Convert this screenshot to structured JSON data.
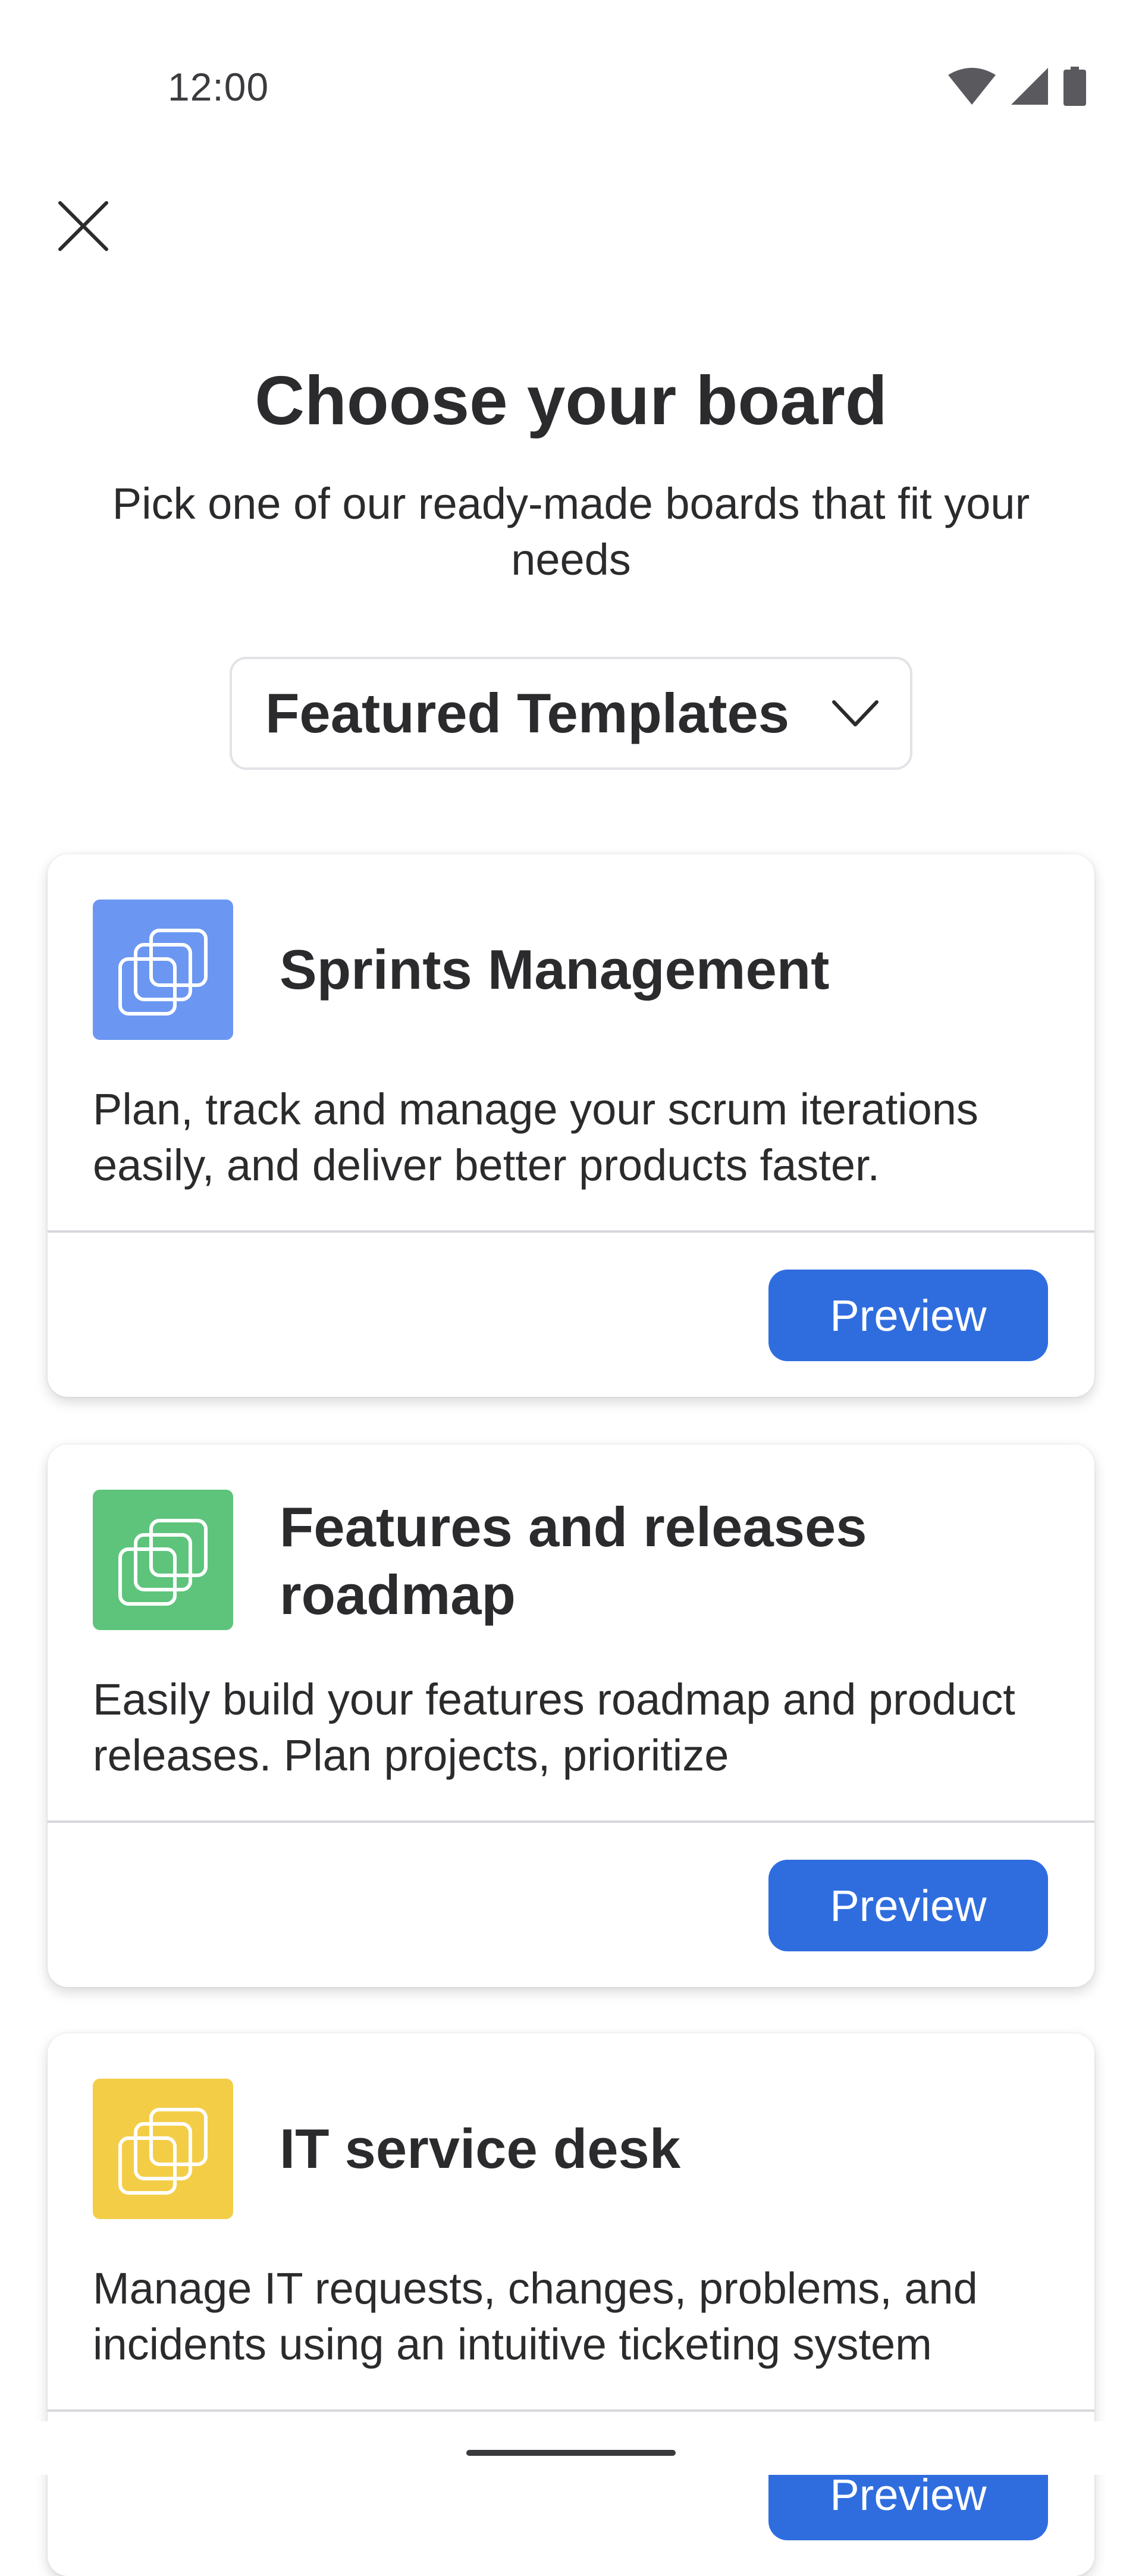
{
  "status_bar": {
    "time": "12:00",
    "icons": [
      "wifi-icon",
      "cellular-signal-icon",
      "battery-icon"
    ]
  },
  "header": {
    "close_icon": "close-icon",
    "title": "Choose your board",
    "subtitle": "Pick one of our ready-made boards that fit your needs"
  },
  "template_selector": {
    "selected": "Featured Templates",
    "icon": "chevron-down-icon"
  },
  "templates": [
    {
      "title": "Sprints Management",
      "description": "Plan, track and manage your scrum iterations easily, and deliver better products faster.",
      "icon_color": "#6b97f2",
      "button_label": "Preview"
    },
    {
      "title": "Features and releases roadmap",
      "description": "Easily build your features roadmap and product releases. Plan projects, prioritize",
      "icon_color": "#5ec47c",
      "button_label": "Preview"
    },
    {
      "title": "IT service desk",
      "description": "Manage IT requests, changes, problems, and incidents using an intuitive ticketing system",
      "icon_color": "#f4cd47",
      "button_label": "Preview"
    }
  ],
  "colors": {
    "accent": "#2f6ddf",
    "text": "#2b2b2e"
  }
}
